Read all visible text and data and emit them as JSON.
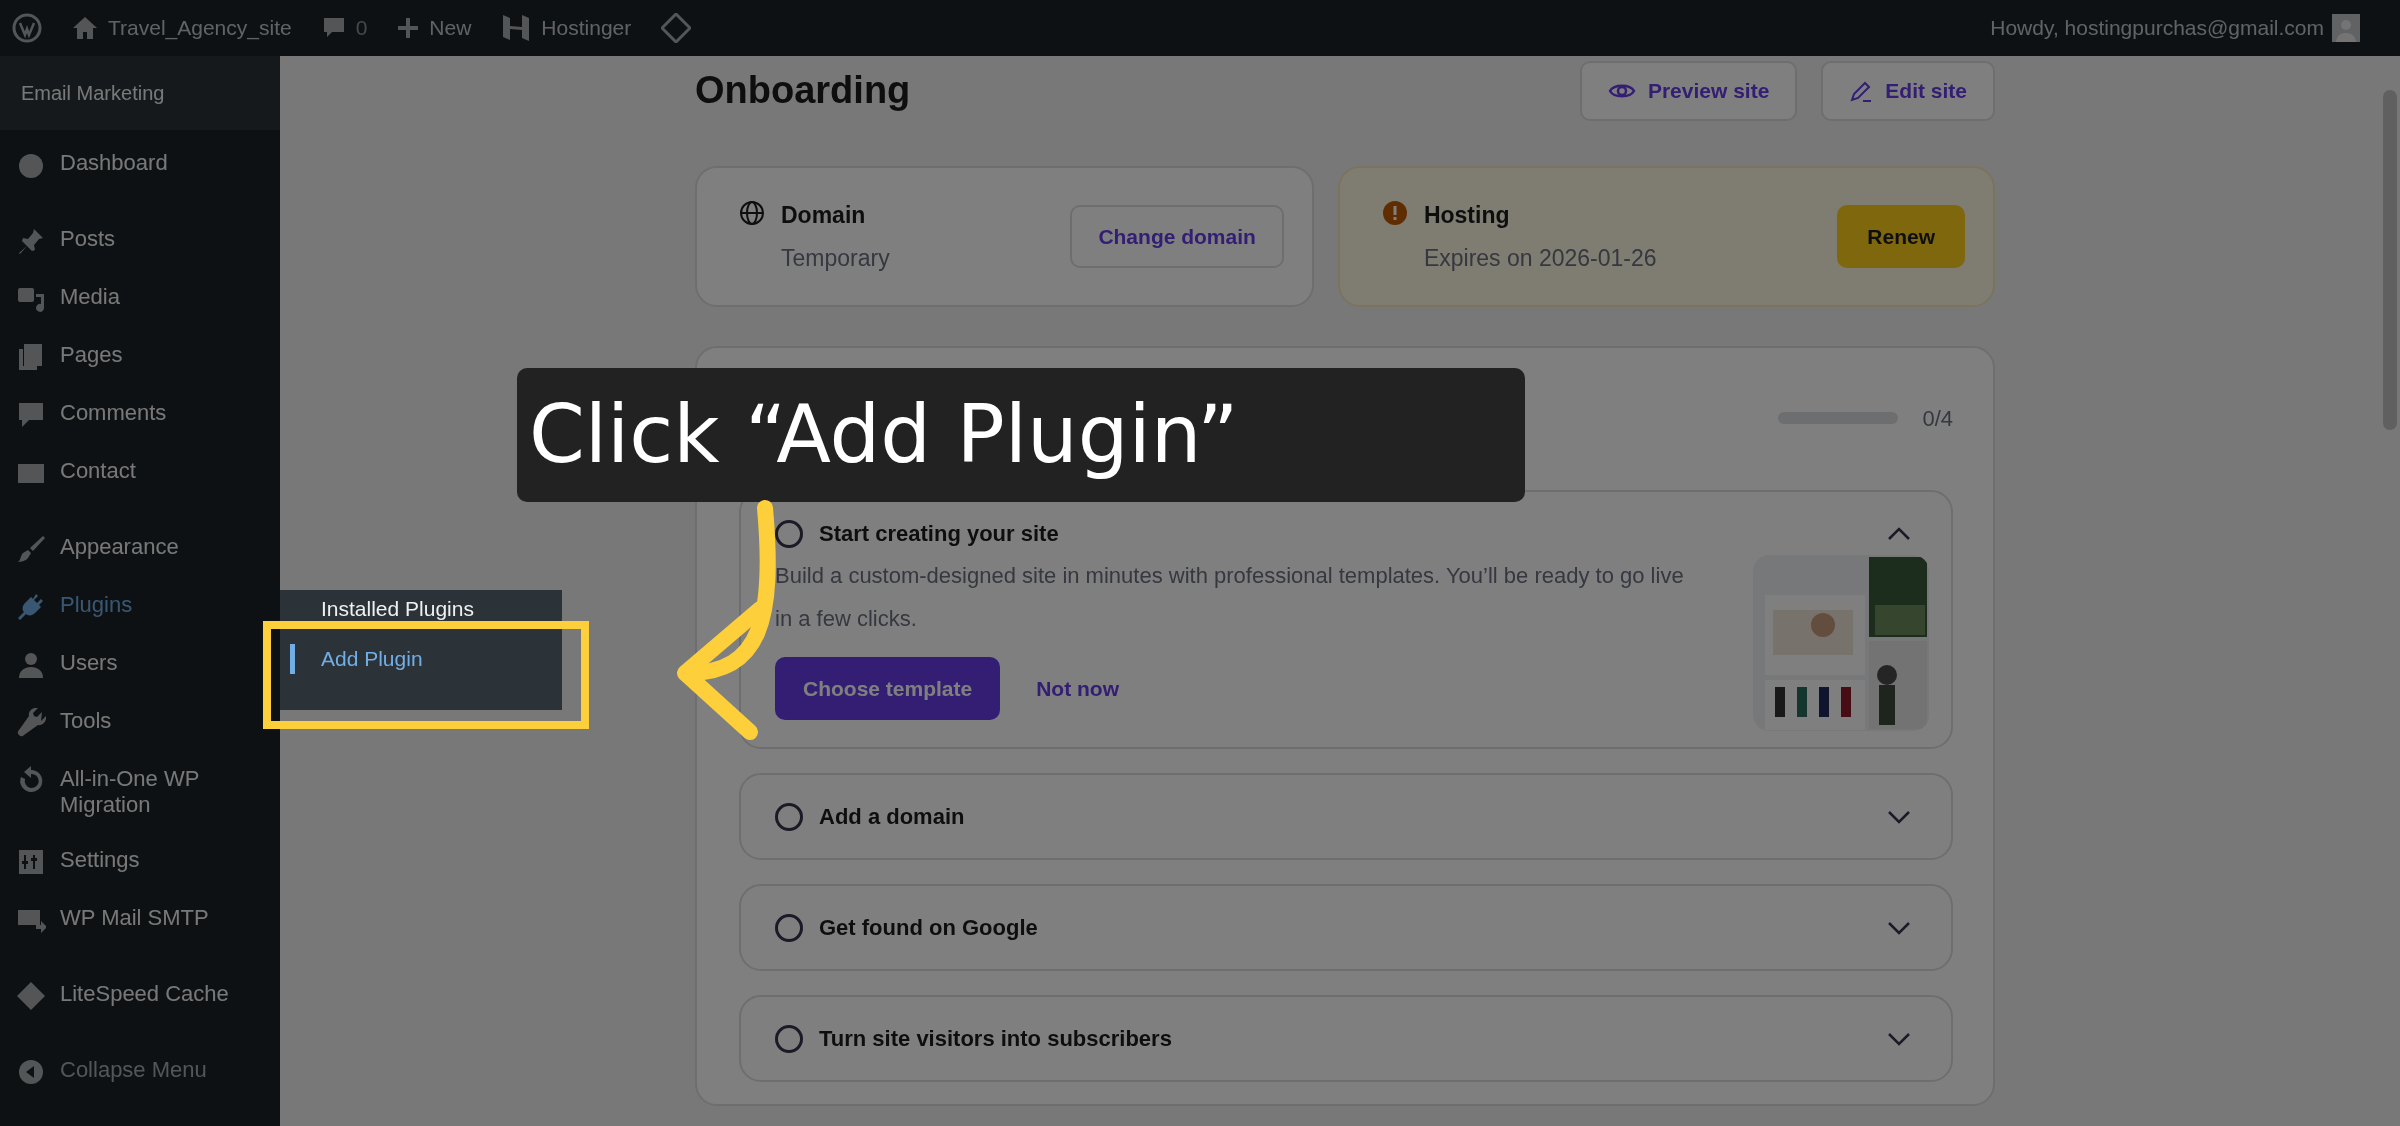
{
  "admin_bar": {
    "site": "Travel_Agency_site",
    "comments": "0",
    "new": "New",
    "hostinger": "Hostinger",
    "greeting": "Howdy, hostingpurchas@gmail.com"
  },
  "sidebar": {
    "header": "Email Marketing",
    "groups": [
      [
        {
          "label": "Dashboard",
          "selected": false
        }
      ],
      [
        {
          "label": "Posts",
          "selected": false
        },
        {
          "label": "Media",
          "selected": false
        },
        {
          "label": "Pages",
          "selected": false
        },
        {
          "label": "Comments",
          "selected": false
        },
        {
          "label": "Contact",
          "selected": false
        }
      ],
      [
        {
          "label": "Appearance",
          "selected": false
        },
        {
          "label": "Plugins",
          "selected": true
        },
        {
          "label": "Users",
          "selected": false
        },
        {
          "label": "Tools",
          "selected": false
        },
        {
          "label": "All-in-One WP Migration",
          "selected": false
        },
        {
          "label": "Settings",
          "selected": false
        },
        {
          "label": "WP Mail SMTP",
          "selected": false
        }
      ],
      [
        {
          "label": "LiteSpeed Cache",
          "selected": false
        }
      ]
    ],
    "collapse": "Collapse Menu"
  },
  "submenu": {
    "items": [
      {
        "label": "Installed Plugins",
        "selected": false
      },
      {
        "label": "Add Plugin",
        "selected": true
      }
    ]
  },
  "page": {
    "title": "Onboarding",
    "buttons": [
      "Preview site",
      "Edit site"
    ],
    "domain": {
      "title": "Domain",
      "subtitle": "Temporary",
      "action": "Change domain"
    },
    "hosting": {
      "title": "Hosting",
      "subtitle": "Expires on 2026-01-26",
      "action": "Renew"
    },
    "setup": {
      "progress": {
        "level": 0,
        "reading": "0/4"
      },
      "steps": [
        {
          "title": "Start creating your site",
          "done": false,
          "expanded": true,
          "description": "Build a custom-designed site in minutes with professional templates. You’ll be ready to go live in a few clicks.",
          "primary": "Choose template",
          "secondary": "Not now",
          "kind": "picture"
        },
        {
          "title": "Add a domain",
          "done": false,
          "expanded": false
        },
        {
          "title": "Get found on Google",
          "done": false,
          "expanded": false
        },
        {
          "title": "Turn site visitors into subscribers",
          "done": false,
          "expanded": false
        }
      ]
    }
  },
  "caption": {
    "text": "Click “Add Plugin”"
  }
}
